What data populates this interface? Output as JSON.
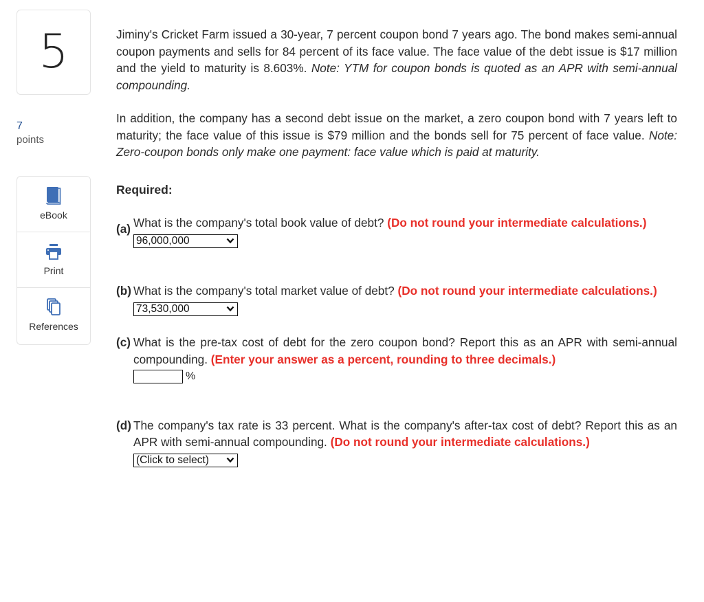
{
  "question": {
    "number": "5",
    "points_value": "7",
    "points_label": "points"
  },
  "tools": [
    {
      "label": "eBook",
      "icon": "book-icon"
    },
    {
      "label": "Print",
      "icon": "printer-icon"
    },
    {
      "label": "References",
      "icon": "documents-icon"
    }
  ],
  "colors": {
    "accent": "#3f6fb6",
    "instruction_red": "#e8302a",
    "points_blue": "#1f4c8f"
  },
  "problem": {
    "para1_text": "Jiminy's Cricket Farm issued a 30-year, 7 percent coupon bond 7 years ago. The bond makes semi-annual coupon payments and sells for 84 percent of its face value. The face value of the debt issue is $17 million and the yield to maturity is 8.603%. ",
    "para1_note": "Note: YTM for coupon bonds is quoted as an APR with semi-annual compounding.",
    "para2_text": "In addition, the company has a second debt issue on the market, a zero coupon bond with 7 years left to maturity; the face value of this issue is $79 million and the bonds sell for 75 percent of face value. ",
    "para2_note": "Note: Zero-coupon bonds only make one payment: face value which is paid at maturity.",
    "required_label": "Required:"
  },
  "parts": {
    "a": {
      "label": "(a)",
      "question": "What is the company's total book value of debt? ",
      "instruction": "(Do not round your intermediate calculations.)",
      "answer": "96,000,000"
    },
    "b": {
      "label": "(b)",
      "question": "What is the company's total market value of debt? ",
      "instruction": "(Do not round your intermediate calculations.)",
      "answer": "73,530,000"
    },
    "c": {
      "label": "(c)",
      "question": "What is the pre-tax cost of debt for the zero coupon bond? Report this as an APR with semi-annual compounding.  ",
      "instruction": "(Enter your answer as a percent, rounding to three decimals.)",
      "answer": "",
      "unit": "%"
    },
    "d": {
      "label": "(d)",
      "question": "The company's tax rate is 33 percent. What is the company's after-tax cost of debt? Report this as an APR with semi-annual compounding. ",
      "instruction": "(Do not round your intermediate calculations.)",
      "answer": "(Click to select)"
    }
  }
}
